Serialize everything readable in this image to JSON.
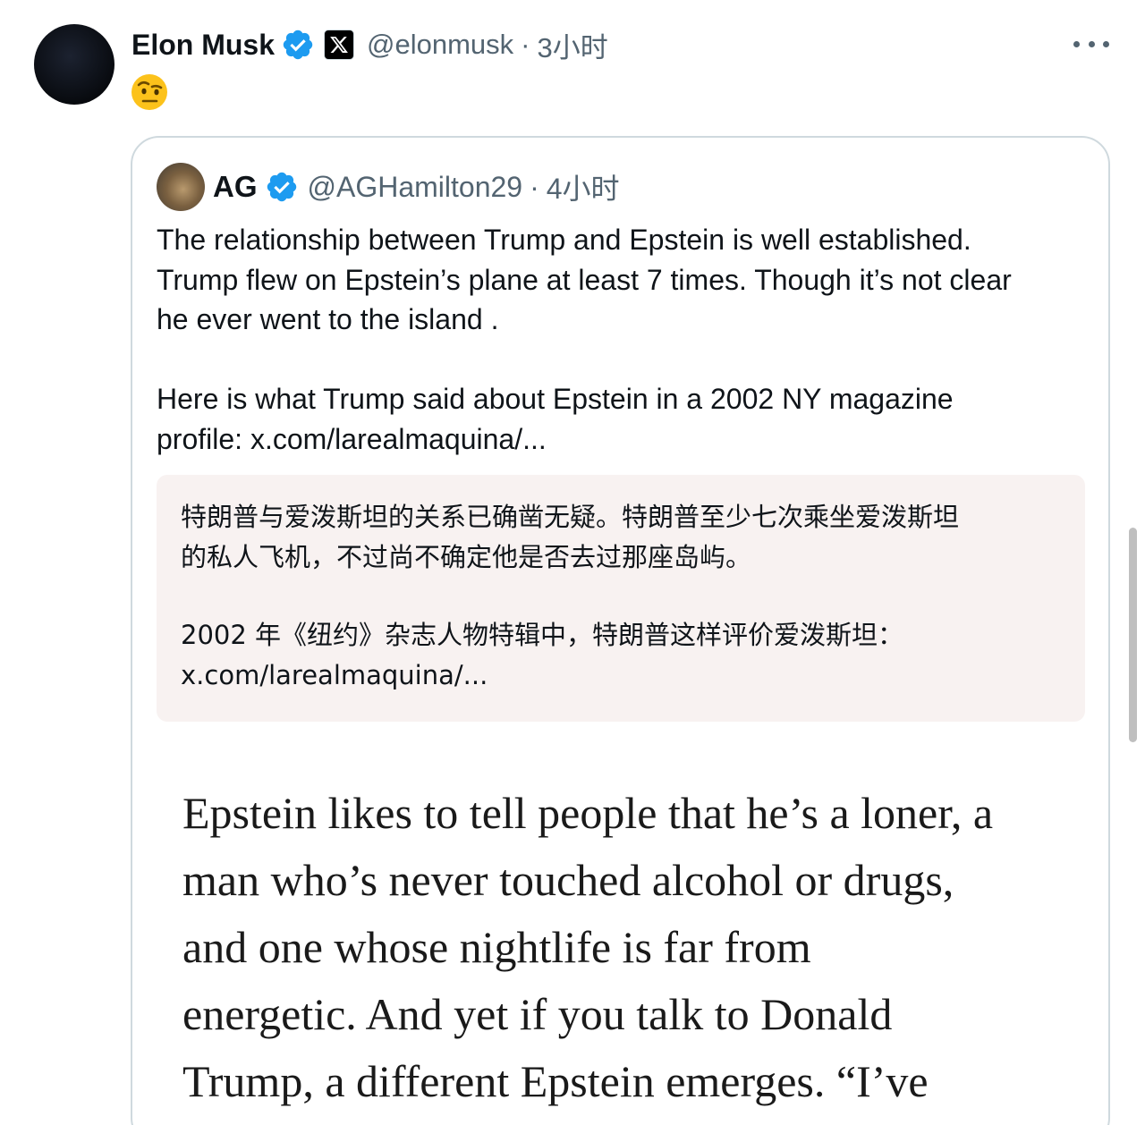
{
  "tweet": {
    "author_name": "Elon Musk",
    "handle": "@elonmusk",
    "separator": "·",
    "time": "3小时",
    "reaction_emoji": "face-with-raised-eyebrow",
    "brand_color": "#1d9bf0"
  },
  "quote": {
    "author_name": "AG",
    "handle": "@AGHamilton29",
    "separator": "·",
    "time": "4小时",
    "text_lines": [
      "The relationship between Trump and Epstein is well established.",
      "Trump flew on Epstein’s plane at least 7 times. Though it’s not clear",
      "he ever went to the island ."
    ],
    "text2_lines": [
      "Here is what Trump said about Epstein in a 2002 NY magazine",
      "profile:  x.com/larealmaquina/..."
    ],
    "translation": {
      "lines": [
        "特朗普与爱泼斯坦的关系已确凿无疑。特朗普至少七次乘坐爱泼斯坦",
        "的私人飞机，不过尚不确定他是否去过那座岛屿。"
      ],
      "lines2": [
        "2002 年《纽约》杂志人物特辑中，特朗普这样评价爱泼斯坦：",
        "x.com/larealmaquina/..."
      ]
    },
    "article_lines": [
      "Epstein likes to tell people that he’s a loner, a",
      "man who’s never touched alcohol or drugs,",
      "and one whose nightlife is far from",
      "energetic. And yet if you talk to Donald",
      "Trump, a different Epstein emerges. “I’ve"
    ]
  }
}
